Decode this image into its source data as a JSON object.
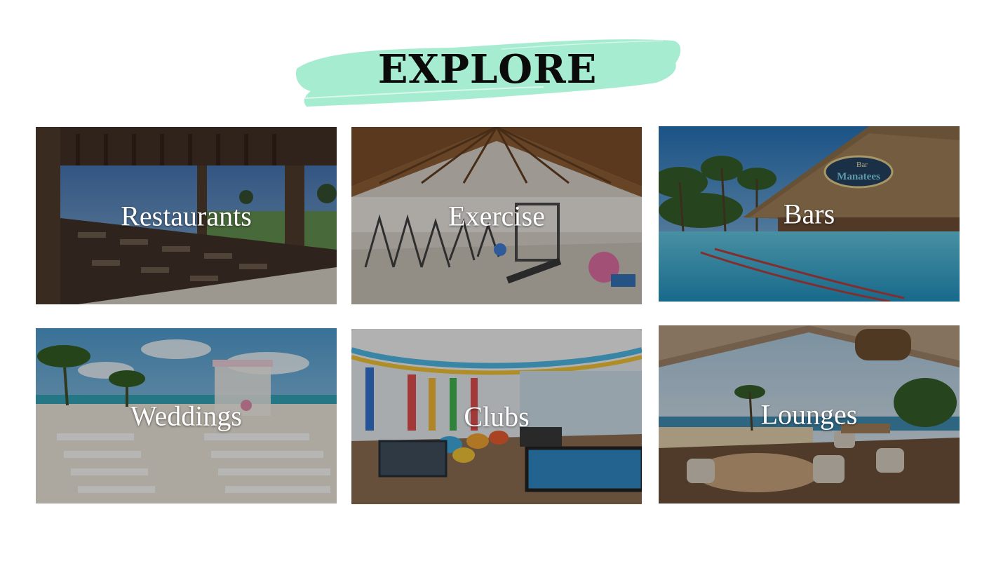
{
  "header": {
    "title": "EXPLORE",
    "brush_color": "#a6ecd0"
  },
  "tiles": [
    {
      "label": "Restaurants"
    },
    {
      "label": "Exercise"
    },
    {
      "label": "Bars",
      "sign_line1": "Bar",
      "sign_line2": "Manatees"
    },
    {
      "label": "Weddings"
    },
    {
      "label": "Clubs"
    },
    {
      "label": "Lounges"
    }
  ]
}
